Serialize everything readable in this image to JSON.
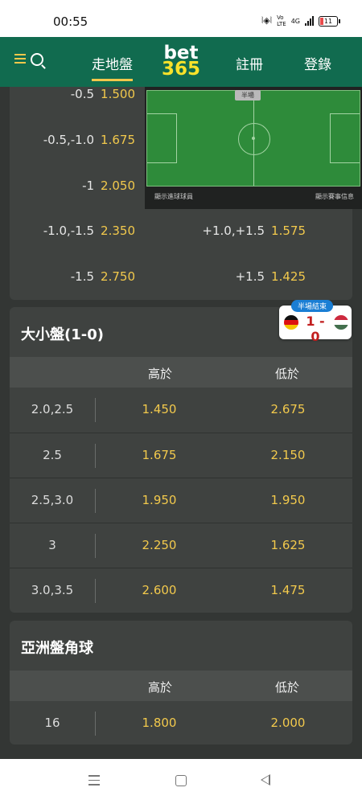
{
  "status_bar": {
    "time": "00:55",
    "network": "4G",
    "battery": "11",
    "vowifi_top": "Vo",
    "vowifi_bottom": "LTE"
  },
  "nav": {
    "tab_live": "走地盤",
    "logo_top": "bet",
    "logo_bottom": "365",
    "tab_register": "註冊",
    "tab_login": "登錄"
  },
  "handicap": {
    "home_rows": [
      {
        "line": "-0.5",
        "odd": "1.500"
      },
      {
        "line": "-0.5,-1.0",
        "odd": "1.675"
      },
      {
        "line": "-1",
        "odd": "2.050"
      },
      {
        "line": "-1.0,-1.5",
        "odd": "2.350"
      },
      {
        "line": "-1.5",
        "odd": "2.750"
      }
    ],
    "away_rows": [
      {
        "line": "+1.0,+1.5",
        "odd": "1.575"
      },
      {
        "line": "+1.5",
        "odd": "1.425"
      }
    ]
  },
  "pitch": {
    "label": "半場",
    "footer_left": "顯示進球球員",
    "footer_right": "顯示賽事信息"
  },
  "score": {
    "status": "半場結束",
    "home": "1",
    "sep": "-",
    "away": "0"
  },
  "over_under": {
    "title": "大小盤(1-0)",
    "col_over": "高於",
    "col_under": "低於",
    "rows": [
      {
        "line": "2.0,2.5",
        "over": "1.450",
        "under": "2.675"
      },
      {
        "line": "2.5",
        "over": "1.675",
        "under": "2.150"
      },
      {
        "line": "2.5,3.0",
        "over": "1.950",
        "under": "1.950"
      },
      {
        "line": "3",
        "over": "2.250",
        "under": "1.625"
      },
      {
        "line": "3.0,3.5",
        "over": "2.600",
        "under": "1.475"
      }
    ]
  },
  "corners": {
    "title": "亞洲盤角球",
    "col_over": "高於",
    "col_under": "低於",
    "rows": [
      {
        "line": "16",
        "over": "1.800",
        "under": "2.000"
      }
    ]
  },
  "colors": {
    "nav_green": "#116b4f",
    "odds_yellow": "#f2c94c",
    "logo_yellow": "#f9e22a",
    "card_bg": "#3f4240",
    "page_bg": "#333634"
  }
}
